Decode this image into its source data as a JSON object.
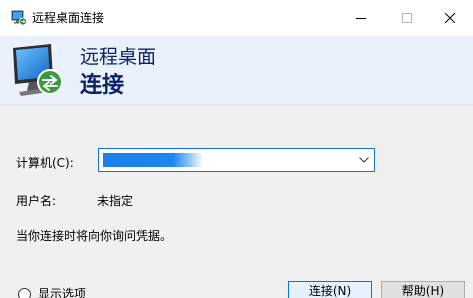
{
  "window": {
    "title": "远程桌面连接",
    "buttons": {
      "minimize": "minimize-icon",
      "maximize": "maximize-icon",
      "close": "close-icon"
    }
  },
  "banner": {
    "line1": "远程桌面",
    "line2": "连接"
  },
  "form": {
    "computer_label": "计算机(C):",
    "computer_value": "",
    "user_label": "用户名:",
    "user_value": "未指定",
    "note": "当你连接时将向你询问凭据。"
  },
  "footer": {
    "options_label": "显示选项",
    "connect_button": "连接(N)",
    "help_button": "帮助(H)"
  },
  "colors": {
    "banner_bg": "#eaf1fb",
    "banner_text": "#0a246a",
    "accent": "#0078d7"
  }
}
